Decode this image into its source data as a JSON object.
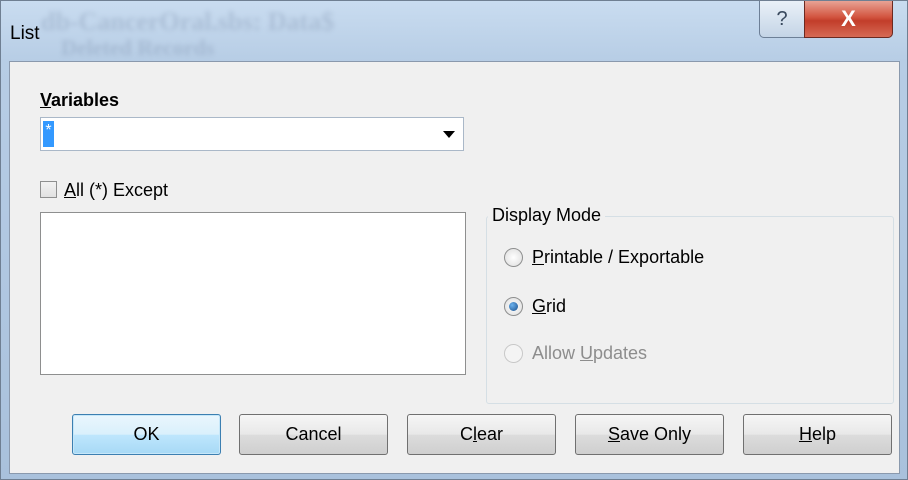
{
  "window": {
    "title": "List",
    "background_title": "db-CancerOral.sbs: Data$",
    "background_title_2": "Deleted Records"
  },
  "titlebar": {
    "help_glyph": "?",
    "close_glyph": "X"
  },
  "variables": {
    "label_key": "V",
    "label_rest": "ariables",
    "value": "*"
  },
  "except_checkbox": {
    "checked": false,
    "label_key": "A",
    "label_rest": "ll (*) Except"
  },
  "except_list": {
    "items": []
  },
  "display_mode": {
    "title": "Display Mode",
    "options": [
      {
        "key": "P",
        "rest": "rintable / Exportable",
        "selected": false,
        "enabled": true
      },
      {
        "key": "G",
        "rest": "rid",
        "selected": true,
        "enabled": true
      },
      {
        "pre": "Allow ",
        "key": "U",
        "rest": "pdates",
        "selected": false,
        "enabled": false
      }
    ]
  },
  "buttons": {
    "ok": "OK",
    "cancel": "Cancel",
    "clear_pre": "C",
    "clear_key": "l",
    "clear_rest": "ear",
    "save_key": "S",
    "save_rest": "ave Only",
    "help_key": "H",
    "help_rest": "elp"
  },
  "colors": {
    "selection": "#3399ff",
    "close_button": "#c23d2a",
    "default_button_border": "#3c7fb1"
  }
}
